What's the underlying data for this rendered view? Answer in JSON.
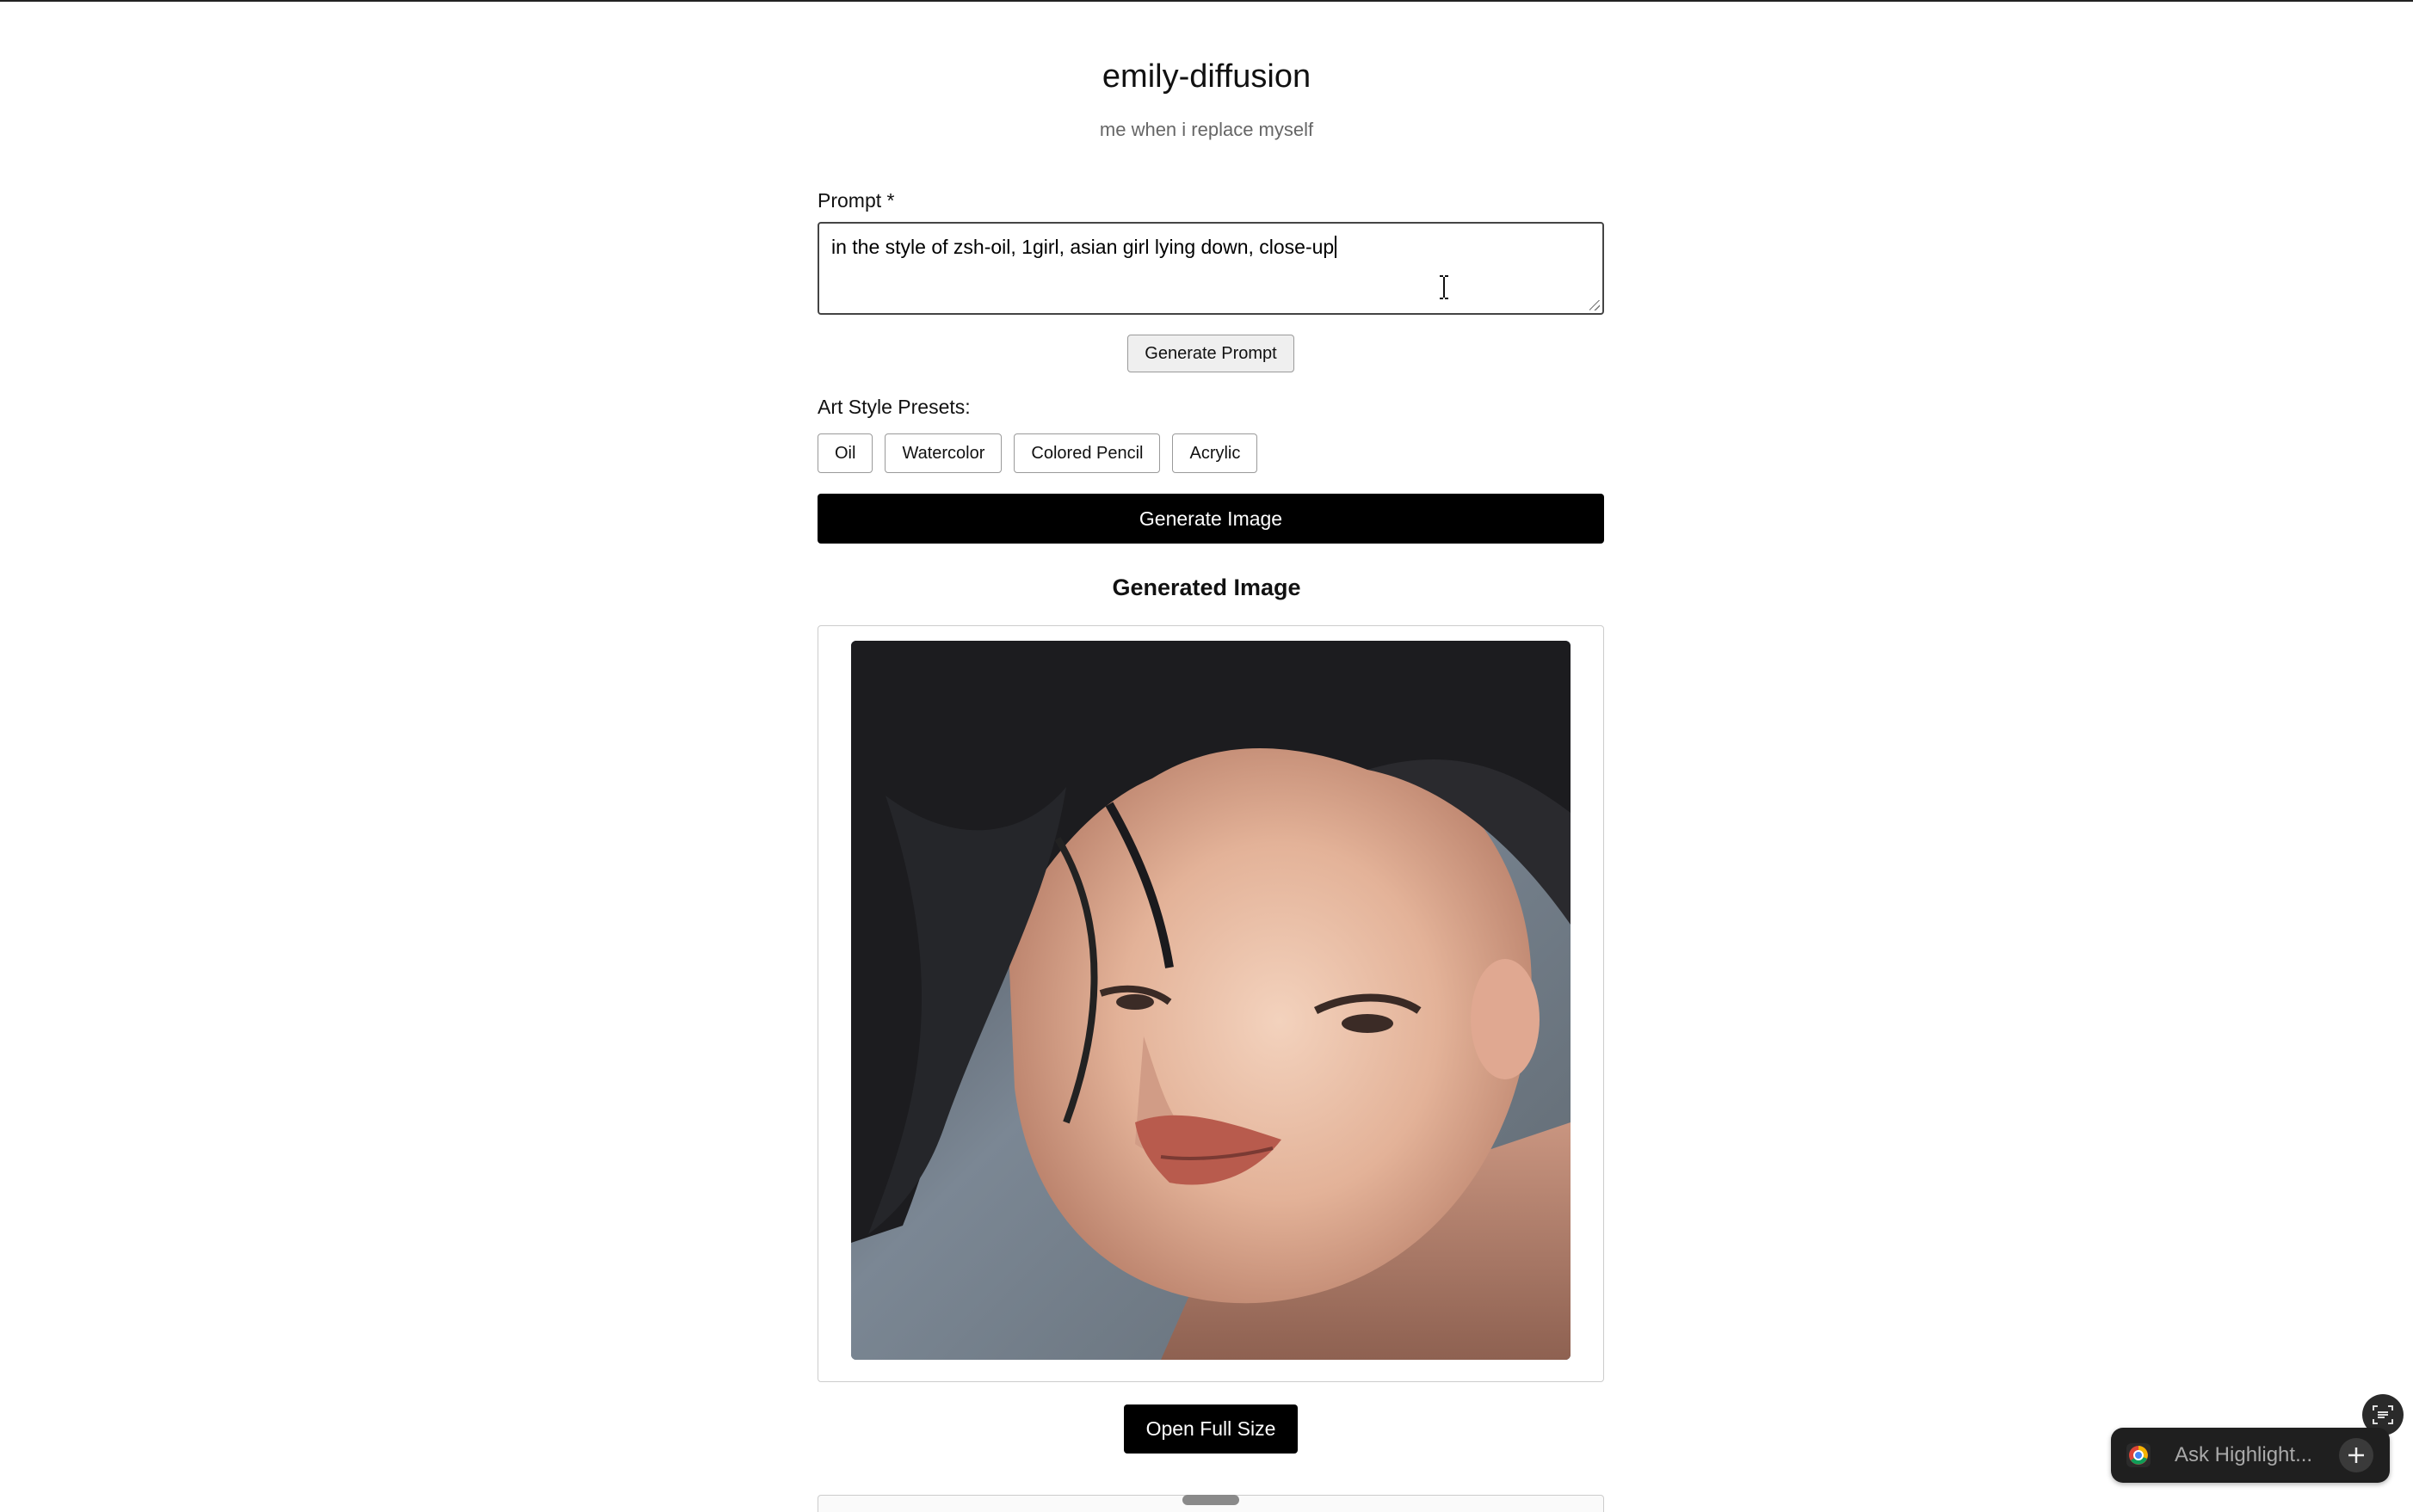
{
  "header": {
    "title": "emily-diffusion",
    "subtitle": "me when i replace myself"
  },
  "prompt": {
    "label": "Prompt *",
    "value": "in the style of zsh-oil, 1girl, asian girl lying down, close-up"
  },
  "generate_prompt_label": "Generate Prompt",
  "presets": {
    "label": "Art Style Presets:",
    "items": [
      "Oil",
      "Watercolor",
      "Colored Pencil",
      "Acrylic"
    ]
  },
  "generate_image_label": "Generate Image",
  "result": {
    "title": "Generated Image",
    "open_full_size_label": "Open Full Size"
  },
  "highlight": {
    "placeholder": "Ask Highlight...",
    "icons": [
      "highlight-logo-icon",
      "plus-icon",
      "scan-icon"
    ]
  },
  "colors": {
    "primary_button": "#000000",
    "primary_button_text": "#ffffff",
    "subtitle": "#666666",
    "overlay_bg": "#1f1f1f"
  }
}
